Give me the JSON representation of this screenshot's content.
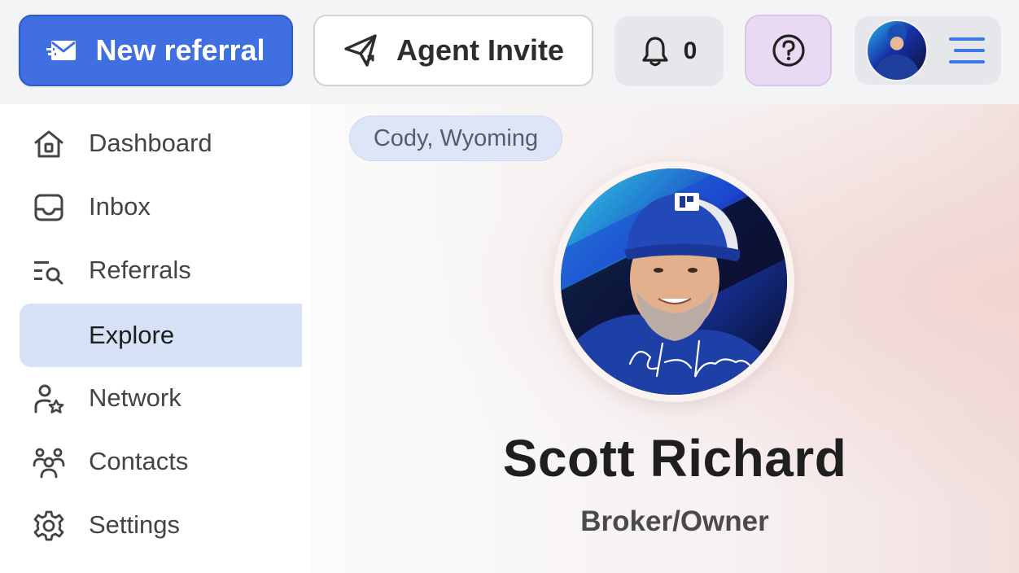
{
  "topbar": {
    "new_referral_label": "New referral",
    "agent_invite_label": "Agent Invite",
    "notification_count": "0",
    "icons": {
      "new_referral": "mail-send-icon",
      "agent_invite": "paper-plane-icon",
      "notifications": "bell-icon",
      "help": "question-circle-icon",
      "menu": "hamburger-menu-icon"
    },
    "colors": {
      "primary": "#3f6fe0",
      "help_bg": "#e9d9f3",
      "menu_accent": "#3d79e6"
    }
  },
  "sidebar": {
    "items": [
      {
        "label": "Dashboard",
        "icon": "home-icon"
      },
      {
        "label": "Inbox",
        "icon": "inbox-icon"
      },
      {
        "label": "Referrals",
        "icon": "list-search-icon"
      },
      {
        "label": "Explore",
        "icon": "",
        "active": true
      },
      {
        "label": "Network",
        "icon": "user-star-icon"
      },
      {
        "label": "Contacts",
        "icon": "users-group-icon"
      },
      {
        "label": "Settings",
        "icon": "gear-icon"
      }
    ],
    "active_color": "#d7e2f7"
  },
  "profile": {
    "location": "Cody, Wyoming",
    "name": "Scott Richard",
    "role": "Broker/Owner"
  }
}
